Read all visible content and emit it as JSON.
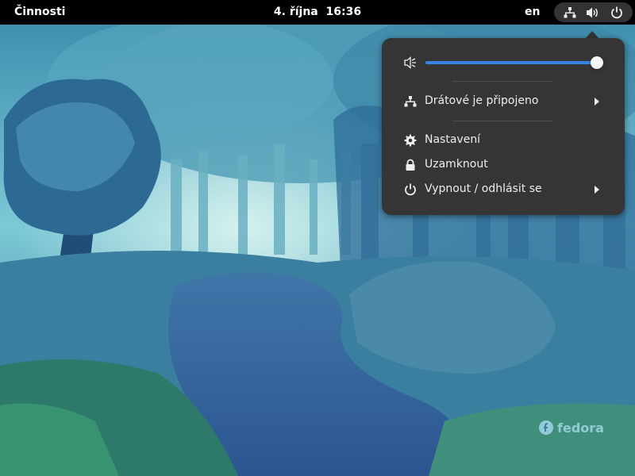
{
  "topbar": {
    "activities_label": "Činnosti",
    "date": "4. října",
    "time": "16:36",
    "input_language": "en",
    "status_icons": [
      "network-wired-icon",
      "volume-icon",
      "power-icon"
    ]
  },
  "system_menu": {
    "volume": {
      "icon": "volume-muted-icon",
      "level": 1.0
    },
    "items": [
      {
        "label": "Drátové je připojeno",
        "icon": "network-wired-icon",
        "has_submenu": true
      },
      {
        "label": "Nastavení",
        "icon": "gear-icon",
        "has_submenu": false
      },
      {
        "label": "Uzamknout",
        "icon": "lock-icon",
        "has_submenu": false
      },
      {
        "label": "Vypnout / odhlásit se",
        "icon": "power-icon",
        "has_submenu": true
      }
    ]
  },
  "wallpaper": {
    "watermark": "fedora"
  },
  "colors": {
    "accent": "#3584e4",
    "panel": "#000000",
    "menu_bg": "#353535"
  }
}
